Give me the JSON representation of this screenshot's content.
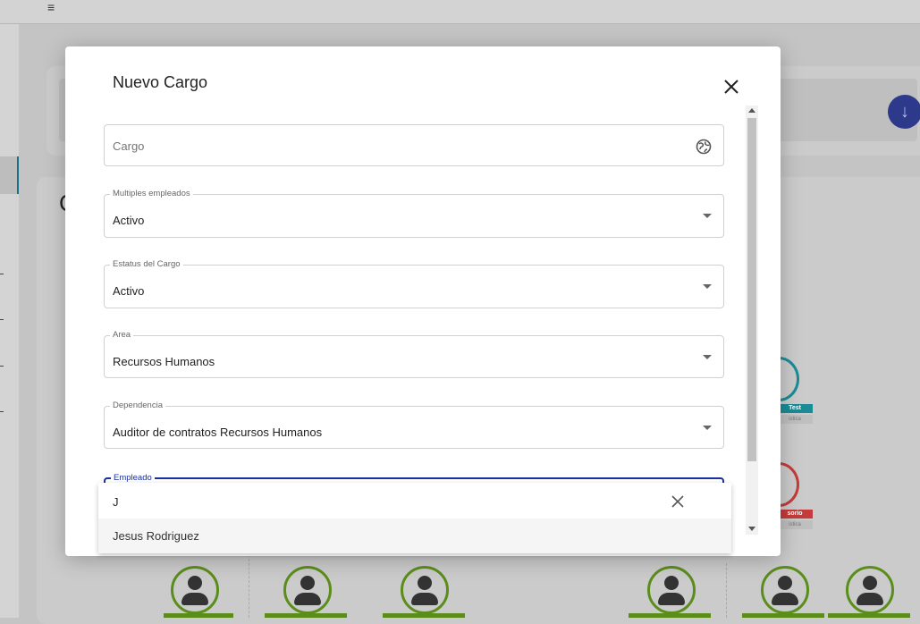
{
  "modal": {
    "title": "Nuevo Cargo",
    "fields": {
      "cargo": {
        "placeholder": "Cargo"
      },
      "multiples_empleados": {
        "label": "Multiples empleados",
        "value": "Activo"
      },
      "estatus_cargo": {
        "label": "Estatus del Cargo",
        "value": "Activo"
      },
      "area": {
        "label": "Area",
        "value": "Recursos Humanos"
      },
      "dependencia": {
        "label": "Dependencia",
        "value": "Auditor de contratos Recursos Humanos"
      },
      "empleado": {
        "label": "Empleado"
      }
    }
  },
  "dropdown": {
    "search_value": "J",
    "options": [
      "Jesus Rodriguez"
    ]
  },
  "background": {
    "menu_glyph": "≡",
    "page_heading_fragment": "C",
    "side_nodes": [
      {
        "label": "Test",
        "sub": "istica",
        "color": "#1a8c96"
      },
      {
        "label": "sorio",
        "sub": "istica",
        "color": "#c53b3b"
      }
    ]
  },
  "icons": {
    "close": "close-icon",
    "field_globe": "globe-icon",
    "caret": "chevron-down-icon",
    "clear": "clear-icon",
    "fab": "arrow-down-icon"
  }
}
